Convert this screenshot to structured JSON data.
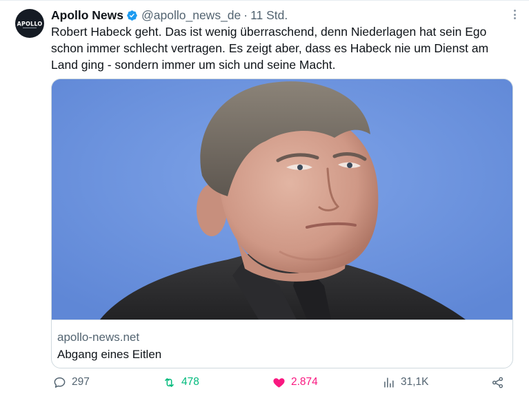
{
  "account": {
    "name": "Apollo News",
    "handle": "@apollo_news_de",
    "separator": "·",
    "time": "11 Std.",
    "avatar_text": "APOLLO",
    "verified_icon": "verified-badge-icon",
    "verified_color": "#1d9bf0"
  },
  "tweet": {
    "text": "Robert Habeck geht. Das ist wenig überraschend, denn Niederlagen hat sein Ego schon immer schlecht vertragen. Es zeigt aber, dass es Habeck nie um Dienst am Land ging - sondern immer um sich und seine Macht."
  },
  "card": {
    "domain": "apollo-news.net",
    "title": "Abgang eines Eitlen",
    "image_background": "#6e95df"
  },
  "actions": {
    "replies": "297",
    "retweets": "478",
    "likes": "2.874",
    "views": "31,1K",
    "colors": {
      "muted": "#536471",
      "retweet": "#00ba7c",
      "like": "#f91880"
    }
  },
  "icons": [
    "more-options-icon",
    "reply-icon",
    "retweet-icon",
    "heart-icon",
    "views-icon",
    "share-icon"
  ]
}
